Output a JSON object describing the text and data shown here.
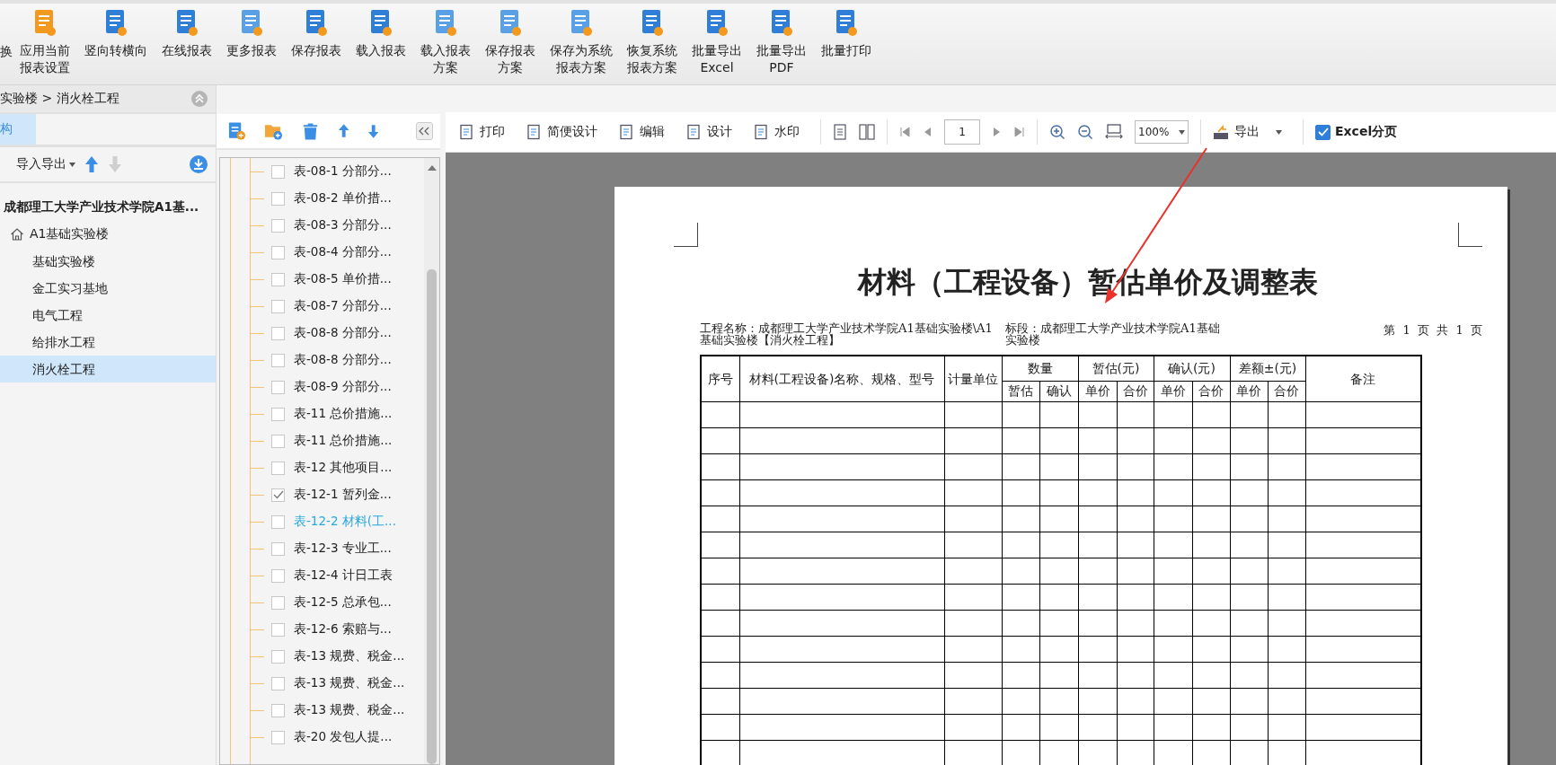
{
  "toolbar": {
    "items": [
      {
        "lines": [
          "换"
        ],
        "kind": "cut"
      },
      {
        "lines": [
          "应用当前",
          "报表设置"
        ],
        "kind": "button"
      },
      {
        "lines": [
          "竖向转横向"
        ],
        "kind": "button"
      },
      {
        "lines": [
          "在线报表"
        ],
        "kind": "button"
      },
      {
        "lines": [
          "更多报表"
        ],
        "kind": "button"
      },
      {
        "lines": [
          "保存报表"
        ],
        "kind": "button"
      },
      {
        "lines": [
          "载入报表"
        ],
        "kind": "button"
      },
      {
        "lines": [
          "载入报表",
          "方案"
        ],
        "kind": "button"
      },
      {
        "lines": [
          "保存报表",
          "方案"
        ],
        "kind": "button"
      },
      {
        "lines": [
          "保存为系统",
          "报表方案"
        ],
        "kind": "button"
      },
      {
        "lines": [
          "恢复系统",
          "报表方案"
        ],
        "kind": "button"
      },
      {
        "lines": [
          "批量导出",
          "Excel"
        ],
        "kind": "button"
      },
      {
        "lines": [
          "批量导出",
          "PDF"
        ],
        "kind": "button"
      },
      {
        "lines": [
          "批量打印"
        ],
        "kind": "button"
      }
    ]
  },
  "project_panel": {
    "breadcrumb": "实验楼 > 消火栓工程",
    "tab": {
      "label": "构",
      "selected": true
    },
    "import_export": "导入导出",
    "tree": {
      "label": "成都理工大学产业技术学院A1基...",
      "children": [
        {
          "label": "A1基础实验楼",
          "children": [
            {
              "label": "基础实验楼",
              "selected": false
            },
            {
              "label": "金工实习基地",
              "selected": false
            },
            {
              "label": "电气工程",
              "selected": false
            },
            {
              "label": "给排水工程",
              "selected": false
            },
            {
              "label": "消火栓工程",
              "selected": true
            }
          ]
        }
      ]
    }
  },
  "report_list": {
    "items": [
      {
        "label": "表-08-1 分部分...",
        "checked": false,
        "selected": false
      },
      {
        "label": "表-08-2 单价措...",
        "checked": false,
        "selected": false
      },
      {
        "label": "表-08-3 分部分...",
        "checked": false,
        "selected": false
      },
      {
        "label": "表-08-4 分部分...",
        "checked": false,
        "selected": false
      },
      {
        "label": "表-08-5 单价措...",
        "checked": false,
        "selected": false
      },
      {
        "label": "表-08-7 分部分...",
        "checked": false,
        "selected": false
      },
      {
        "label": "表-08-8 分部分...",
        "checked": false,
        "selected": false
      },
      {
        "label": "表-08-8 分部分...",
        "checked": false,
        "selected": false
      },
      {
        "label": "表-08-9 分部分...",
        "checked": false,
        "selected": false
      },
      {
        "label": "表-11 总价措施...",
        "checked": false,
        "selected": false
      },
      {
        "label": "表-11 总价措施...",
        "checked": false,
        "selected": false
      },
      {
        "label": "表-12 其他项目...",
        "checked": false,
        "selected": false
      },
      {
        "label": "表-12-1 暂列金...",
        "checked": true,
        "selected": false
      },
      {
        "label": "表-12-2 材料(工...",
        "checked": false,
        "selected": true
      },
      {
        "label": "表-12-3 专业工...",
        "checked": false,
        "selected": false
      },
      {
        "label": "表-12-4 计日工表",
        "checked": false,
        "selected": false
      },
      {
        "label": "表-12-5 总承包...",
        "checked": false,
        "selected": false
      },
      {
        "label": "表-12-6 索赔与...",
        "checked": false,
        "selected": false
      },
      {
        "label": "表-13 规费、税金...",
        "checked": false,
        "selected": false
      },
      {
        "label": "表-13 规费、税金...",
        "checked": false,
        "selected": false
      },
      {
        "label": "表-13 规费、税金...",
        "checked": false,
        "selected": false
      },
      {
        "label": "表-20 发包人提...",
        "checked": false,
        "selected": false
      }
    ]
  },
  "preview": {
    "buttons": [
      {
        "label": "打印"
      },
      {
        "label": "简便设计"
      },
      {
        "label": "编辑"
      },
      {
        "label": "设计"
      },
      {
        "label": "水印"
      }
    ],
    "page_number": "1",
    "zoom": "100%",
    "export": "导出",
    "excel_paging": {
      "label": "Excel分页",
      "checked": true
    }
  },
  "report": {
    "title": "材料（工程设备）暂估单价及调整表",
    "project": "工程名称：成都理工大学产业技术学院A1基础实验楼\\A1 基础实验楼【消火栓工程】",
    "section": "标段：成都理工大学产业技术学院A1基础实验楼",
    "page_info": "第  1  页  共  1  页",
    "columns": [
      {
        "label": "序号"
      },
      {
        "label": "材料(工程设备)名称、规格、型号"
      },
      {
        "label": "计量单位"
      },
      {
        "label": "数量",
        "subcolumns": [
          "暂估",
          "确认"
        ]
      },
      {
        "label": "暂估(元)",
        "subcolumns": [
          "单价",
          "合价"
        ]
      },
      {
        "label": "确认(元)",
        "subcolumns": [
          "单价",
          "合价"
        ]
      },
      {
        "label": "差额±(元)",
        "subcolumns": [
          "单价",
          "合价"
        ]
      },
      {
        "label": "备注"
      }
    ]
  }
}
